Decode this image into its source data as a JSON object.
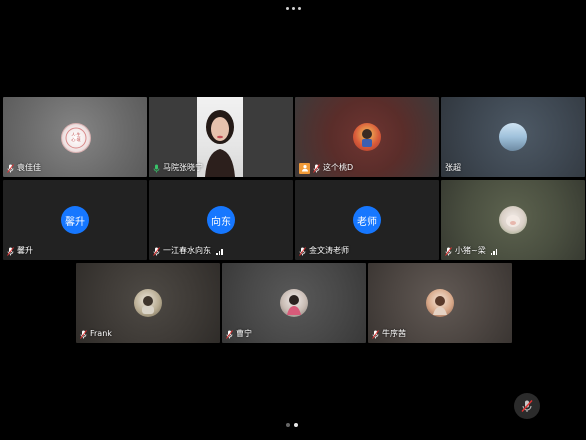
{
  "participants": [
    {
      "name": "袁佳佳",
      "avatar_text": "",
      "icon": "microphone-muted-icon"
    },
    {
      "name": "马院张晓宁",
      "avatar_text": "",
      "icon": "microphone-active-icon",
      "active_speaker": true
    },
    {
      "name": "这个桃D",
      "avatar_text": "",
      "icon": "microphone-muted-icon",
      "badge": "person-badge-icon"
    },
    {
      "name": "张超",
      "avatar_text": "",
      "icon": ""
    },
    {
      "name": "馨升",
      "avatar_text": "馨升",
      "icon": "microphone-muted-icon"
    },
    {
      "name": "一江春水向东",
      "avatar_text": "向东",
      "icon": "microphone-muted-icon",
      "signal": true
    },
    {
      "name": "金文涛老师",
      "avatar_text": "老师",
      "icon": "microphone-muted-icon"
    },
    {
      "name": "小猪~梁",
      "avatar_text": "",
      "icon": "microphone-muted-icon",
      "signal": true
    },
    {
      "name": "Frank",
      "avatar_text": "",
      "icon": "microphone-muted-icon"
    },
    {
      "name": "曹宁",
      "avatar_text": "",
      "icon": "microphone-muted-icon"
    },
    {
      "name": "牛序茜",
      "avatar_text": "",
      "icon": "microphone-muted-icon"
    }
  ],
  "pager": {
    "pages": 2,
    "current": 2
  },
  "colors": {
    "accent": "#1677ff",
    "active_border": "#39c46a",
    "badge": "#f29a38"
  },
  "controls": {
    "mute_icon": "microphone-muted-icon",
    "more_icon": "more-dots-icon"
  }
}
